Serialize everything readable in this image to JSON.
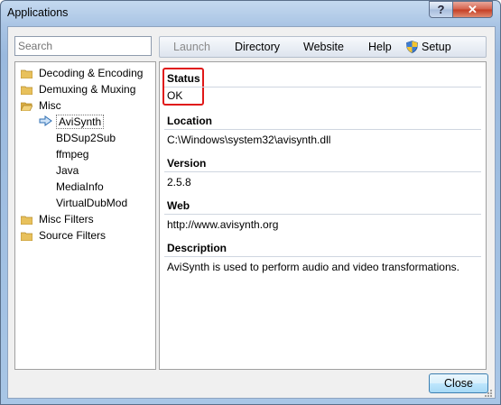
{
  "window": {
    "title": "Applications"
  },
  "search": {
    "placeholder": "Search"
  },
  "tree": {
    "items": [
      {
        "label": "Decoding & Encoding",
        "type": "folder"
      },
      {
        "label": "Demuxing & Muxing",
        "type": "folder"
      },
      {
        "label": "Misc",
        "type": "folder"
      },
      {
        "label": "AviSynth",
        "type": "item",
        "selected": true
      },
      {
        "label": "BDSup2Sub",
        "type": "item"
      },
      {
        "label": "ffmpeg",
        "type": "item"
      },
      {
        "label": "Java",
        "type": "item"
      },
      {
        "label": "MediaInfo",
        "type": "item"
      },
      {
        "label": "VirtualDubMod",
        "type": "item"
      },
      {
        "label": "Misc Filters",
        "type": "folder"
      },
      {
        "label": "Source Filters",
        "type": "folder"
      }
    ]
  },
  "toolbar": {
    "launch": "Launch",
    "directory": "Directory",
    "website": "Website",
    "help": "Help",
    "setup": "Setup"
  },
  "details": {
    "status_label": "Status",
    "status_value": "OK",
    "location_label": "Location",
    "location_value": "C:\\Windows\\system32\\avisynth.dll",
    "version_label": "Version",
    "version_value": "2.5.8",
    "web_label": "Web",
    "web_value": "http://www.avisynth.org",
    "description_label": "Description",
    "description_value": "AviSynth is used to perform audio and video transformations."
  },
  "buttons": {
    "close": "Close"
  },
  "colors": {
    "highlight_box": "#e01818",
    "title_gradient": "#a9c4e4",
    "close_x": "#c43c22"
  }
}
